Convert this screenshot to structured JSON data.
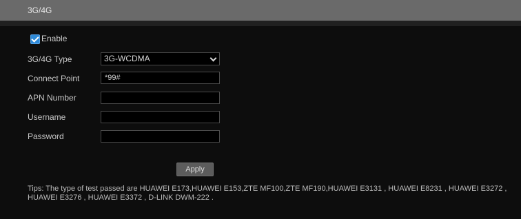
{
  "header": {
    "title": "3G/4G"
  },
  "enable": {
    "label": "Enable",
    "checked": true
  },
  "form": {
    "type_label": "3G/4G Type",
    "type_value": "3G-WCDMA",
    "connect_point_label": "Connect Point",
    "connect_point_value": "*99#",
    "apn_label": "APN Number",
    "apn_value": "",
    "username_label": "Username",
    "username_value": "",
    "password_label": "Password",
    "password_value": ""
  },
  "apply_label": "Apply",
  "tips": "Tips: The type of test passed are HUAWEI E173,HUAWEI E153,ZTE MF100,ZTE MF190,HUAWEI E3131 ,  HUAWEI E8231 ,  HUAWEI E3272 ,  HUAWEI E3276 ,  HUAWEI E3372 ,  D-LINK DWM-222 .",
  "colors": {
    "header_bg": "#6a6a6a",
    "background": "#0d0d0d",
    "checkbox": "#2e8ad8",
    "button": "#5c5c5c"
  },
  "icons": [
    "checkbox-checked-icon",
    "chevron-down-icon"
  ]
}
